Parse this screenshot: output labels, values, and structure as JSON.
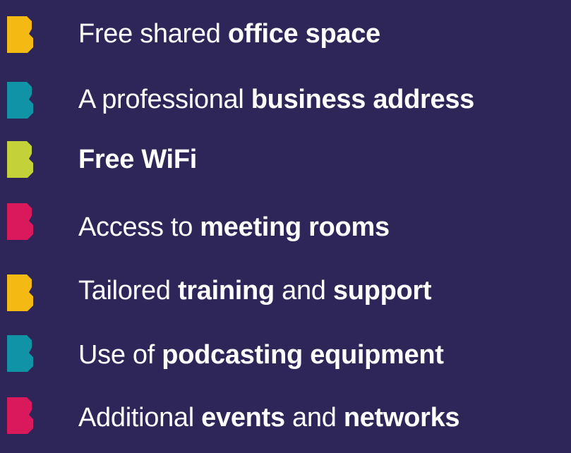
{
  "colors": {
    "background": "#2e2658",
    "yellow": "#f5b914",
    "teal": "#0f93a5",
    "lime": "#c4d239",
    "pink": "#d9195c"
  },
  "items": [
    {
      "icon": "b-logo-bullet-icon",
      "color": "#f5b914",
      "parts": [
        {
          "text": "Free shared ",
          "bold": false
        },
        {
          "text": "office space",
          "bold": true
        }
      ]
    },
    {
      "icon": "b-logo-bullet-icon",
      "color": "#0f93a5",
      "parts": [
        {
          "text": "A professional ",
          "bold": false
        },
        {
          "text": "business address",
          "bold": true
        }
      ]
    },
    {
      "icon": "b-logo-bullet-icon",
      "color": "#c4d239",
      "parts": [
        {
          "text": "Free WiFi",
          "bold": true
        }
      ]
    },
    {
      "icon": "b-logo-bullet-icon",
      "color": "#d9195c",
      "parts": [
        {
          "text": "Access to ",
          "bold": false
        },
        {
          "text": "meeting rooms",
          "bold": true
        }
      ]
    },
    {
      "icon": "b-logo-bullet-icon",
      "color": "#f5b914",
      "parts": [
        {
          "text": "Tailored ",
          "bold": false
        },
        {
          "text": "training",
          "bold": true
        },
        {
          "text": " and ",
          "bold": false
        },
        {
          "text": "support",
          "bold": true
        }
      ]
    },
    {
      "icon": "b-logo-bullet-icon",
      "color": "#0f93a5",
      "parts": [
        {
          "text": "Use of ",
          "bold": false
        },
        {
          "text": "podcasting equipment",
          "bold": true
        }
      ]
    },
    {
      "icon": "b-logo-bullet-icon",
      "color": "#d9195c",
      "parts": [
        {
          "text": "Additional ",
          "bold": false
        },
        {
          "text": "events",
          "bold": true
        },
        {
          "text": " and ",
          "bold": false
        },
        {
          "text": "networks",
          "bold": true
        }
      ]
    }
  ]
}
